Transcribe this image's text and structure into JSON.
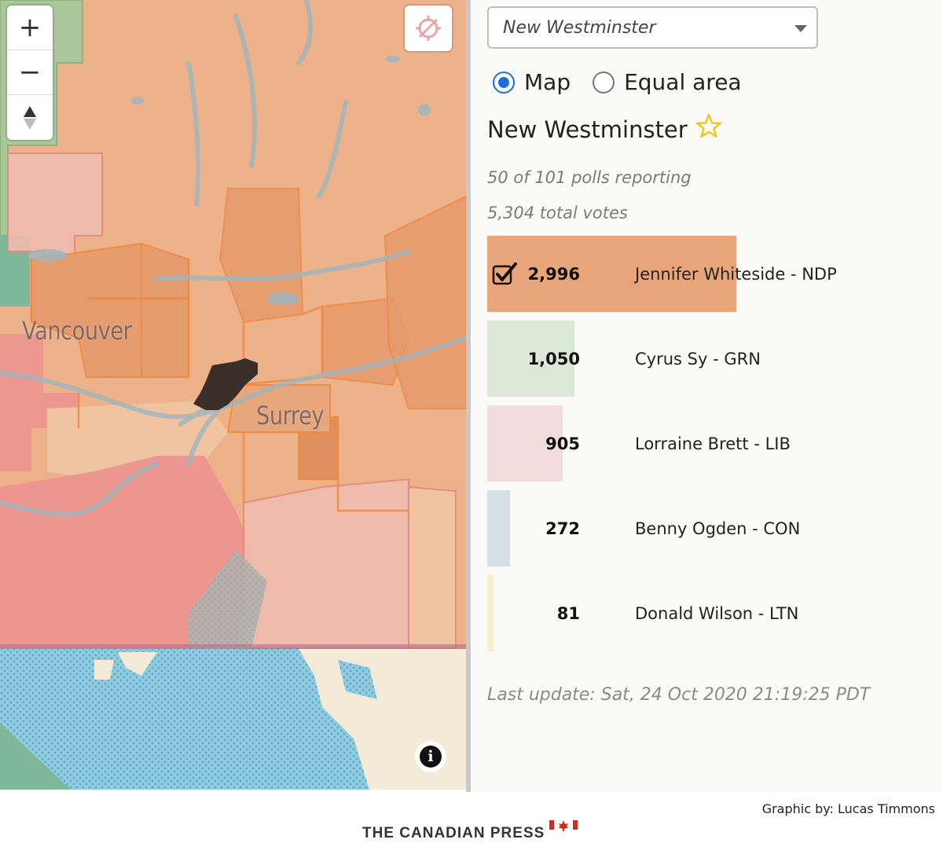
{
  "map": {
    "labels": {
      "vancouver": "Vancouver",
      "surrey": "Surrey"
    },
    "controls": {
      "zoom_in": "+",
      "zoom_out": "−",
      "compass_icon": "compass-icon",
      "info_icon": "info-icon",
      "info_label": "i"
    },
    "colors": {
      "ndp": "#e9a57a",
      "lib": "#ec8c8c",
      "grn": "#9cc79a",
      "water": "#8ecfe0",
      "selected": "#3a2e28"
    }
  },
  "riding_select": {
    "value": "New Westminster"
  },
  "view_toggle": {
    "options": [
      "Map",
      "Equal area"
    ],
    "selected": "Map"
  },
  "riding": {
    "name": "New Westminster",
    "polls_reporting": "50 of 101 polls reporting",
    "total_votes": "5,304 total votes",
    "candidates": [
      {
        "votes": "2,996",
        "name": "Jennifer Whiteside - NDP",
        "share": 0.565,
        "color": "#e9a57a",
        "winner": true
      },
      {
        "votes": "1,050",
        "name": "Cyrus Sy - GRN",
        "share": 0.198,
        "color": "#dce9d8",
        "winner": false
      },
      {
        "votes": "905",
        "name": "Lorraine Brett - LIB",
        "share": 0.171,
        "color": "#f3dcdd",
        "winner": false
      },
      {
        "votes": "272",
        "name": "Benny Ogden - CON",
        "share": 0.051,
        "color": "#d4dfe6",
        "winner": false
      },
      {
        "votes": "81",
        "name": "Donald Wilson - LTN",
        "share": 0.015,
        "color": "#f6efcc",
        "winner": false
      }
    ],
    "last_update": "Last update: Sat, 24 Oct 2020 21:19:25 PDT"
  },
  "footer": {
    "credit": "Graphic by: Lucas Timmons",
    "publisher": "THE CANADIAN PRESS"
  }
}
